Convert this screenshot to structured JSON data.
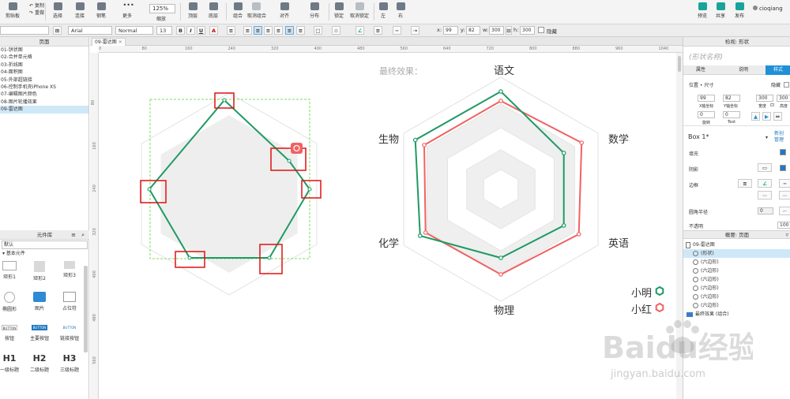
{
  "toolbar": {
    "items": [
      {
        "label": "剪贴板"
      },
      {
        "label": "选择"
      },
      {
        "label": "连接"
      },
      {
        "label": "钢笔"
      },
      {
        "label": "更多"
      },
      {
        "label": "顶层"
      },
      {
        "label": "底层"
      },
      {
        "label": "组合"
      },
      {
        "label": "取消组合"
      },
      {
        "label": "对齐"
      },
      {
        "label": "分布"
      },
      {
        "label": "锁定"
      },
      {
        "label": "取消锁定"
      },
      {
        "label": "左"
      },
      {
        "label": "右"
      },
      {
        "label": "预览"
      },
      {
        "label": "共享"
      },
      {
        "label": "发布"
      }
    ],
    "clipboard_top": "复制",
    "clipboard_bottom": "重做",
    "zoom": "125%",
    "zoom_label": "缩放",
    "user": "cioqiang"
  },
  "format": {
    "font": "Arial",
    "style": "Normal",
    "size": "13",
    "x_label": "x:",
    "x": "99",
    "y_label": "y:",
    "y": "82",
    "w_label": "w:",
    "w": "300",
    "h_label": "h:",
    "h": "300",
    "hide": "隐藏"
  },
  "pages": {
    "header": "页面",
    "items": [
      "01-饼状图",
      "02-合并单元格",
      "03-折线图",
      "04-面积图",
      "05-外部超链接",
      "06-控制手机壳iPhone XS",
      "07-编辑图片颜色",
      "08-图片轮播效果",
      "09-雷达图"
    ],
    "selected": 8
  },
  "library": {
    "header": "元件库",
    "select": "默认",
    "section": "基本元件",
    "items": [
      {
        "label": "矩形1"
      },
      {
        "label": "矩形2"
      },
      {
        "label": "矩形3"
      },
      {
        "label": "椭圆形"
      },
      {
        "label": "图片"
      },
      {
        "label": "占位符"
      },
      {
        "label": "按钮"
      },
      {
        "label": "主要按钮"
      },
      {
        "label": "链接按钮"
      },
      {
        "label": "一级标题",
        "glyph": "H1"
      },
      {
        "label": "二级标题",
        "glyph": "H2"
      },
      {
        "label": "三级标题",
        "glyph": "H3"
      }
    ],
    "button_text": "BUTTON"
  },
  "canvas": {
    "tab": "09-雷达图",
    "ruler_top": [
      "0",
      "80",
      "160",
      "240",
      "320",
      "400",
      "480",
      "560",
      "640",
      "720",
      "800",
      "880",
      "960",
      "1040"
    ],
    "ruler_left": [
      "80",
      "160",
      "240",
      "320",
      "400",
      "480",
      "560"
    ],
    "title": "最终效果：",
    "axes": [
      "语文",
      "数学",
      "英语",
      "物理",
      "化学",
      "生物"
    ],
    "legend": [
      {
        "name": "小明",
        "color": "#1e9a64"
      },
      {
        "name": "小红",
        "color": "#f06262"
      }
    ],
    "colors": {
      "green": "#1e9a64",
      "red": "#f06262",
      "highlight": "#e01010",
      "guide": "#7ddc5e"
    }
  },
  "right": {
    "header": "检视: 形状",
    "shape_name": "(形状名称)",
    "tabs": [
      "属性",
      "说明",
      "样式"
    ],
    "section_pos": "位置 • 尺寸",
    "hide": "隐藏",
    "x": "99",
    "y": "82",
    "w": "300",
    "h": "300",
    "x_cap": "X轴坐标",
    "y_cap": "Y轴坐标",
    "w_cap": "宽度",
    "h_cap": "高度",
    "rot": "0",
    "rot_cap": "旋转",
    "text_rot": "0",
    "text_cap": "Text",
    "style_name": "Box 1*",
    "create": "新创",
    "manage": "管理",
    "fill": "填充",
    "shadow": "阴影",
    "border": "边框",
    "radius": "圆角半径",
    "radius_val": "0",
    "opacity": "不透明",
    "opacity_val": "100",
    "outline_header": "概要: 页面",
    "outline": [
      {
        "label": "09-雷达图",
        "kind": "page"
      },
      {
        "label": "(形状)",
        "kind": "shape",
        "sel": true
      },
      {
        "label": "(六边形)",
        "kind": "shape"
      },
      {
        "label": "(六边形)",
        "kind": "shape"
      },
      {
        "label": "(六边形)",
        "kind": "shape"
      },
      {
        "label": "(六边形)",
        "kind": "shape"
      },
      {
        "label": "(六边形)",
        "kind": "shape"
      },
      {
        "label": "(六边形)",
        "kind": "shape"
      },
      {
        "label": "最终效果 (组合)",
        "kind": "group"
      }
    ]
  },
  "watermark": {
    "main": "Baidu经验",
    "url": "jingyan.baidu.com"
  }
}
